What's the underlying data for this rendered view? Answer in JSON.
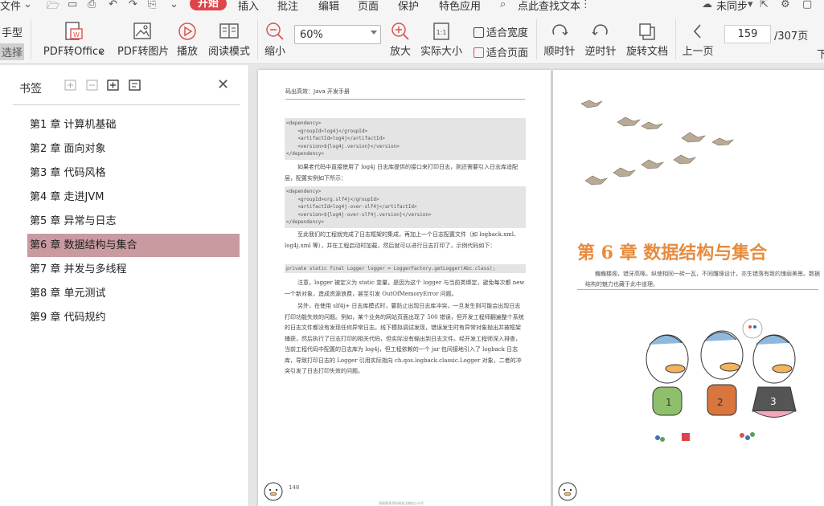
{
  "menubar": {
    "file": "文件",
    "start": "开始",
    "insert": "插入",
    "annotate": "批注",
    "edit": "编辑",
    "page": "页面",
    "protect": "保护",
    "features": "特色应用",
    "search": "点此查找文本",
    "sync": "未同步",
    "accent_color": "#e0444b"
  },
  "toolbar": {
    "hand": "手型",
    "select": "选择",
    "pdf_to_office": "PDF转Office",
    "pdf_to_image": "PDF转图片",
    "play": "播放",
    "read_mode": "阅读模式",
    "zoom_out": "缩小",
    "zoom_value": "60%",
    "zoom_in": "放大",
    "actual_size": "实际大小",
    "fit_width": "适合宽度",
    "fit_page": "适合页面",
    "rotate_cw": "顺时针",
    "rotate_ccw": "逆时针",
    "rotate_doc": "旋转文档",
    "prev_page": "上一页",
    "current_page": "159",
    "total_pages": "/307页",
    "next_page_partial": "下"
  },
  "sidebar": {
    "title": "书签",
    "items": [
      {
        "label": "第1 章 计算机基础"
      },
      {
        "label": "第2 章 面向对象"
      },
      {
        "label": "第3 章 代码风格"
      },
      {
        "label": "第4 章 走进JVM"
      },
      {
        "label": "第5 章 异常与日志"
      },
      {
        "label": "第6 章 数据结构与集合"
      },
      {
        "label": "第7 章 并发与多线程"
      },
      {
        "label": "第8 章 单元测试"
      },
      {
        "label": "第9 章 代码规约"
      }
    ],
    "selected_index": 5,
    "selected_color": "#c99aa0"
  },
  "page_left": {
    "header": "码出高效：Java 开发手册",
    "code1": [
      "<dependency>",
      "    <groupId>log4j</groupId>",
      "    <artifactId>log4j</artifactId>",
      "    <version>${log4j.version}</version>",
      "</dependency>"
    ],
    "p1": "如果老代码中直接使用了 log4j 日志库提供的接口来打印日志，则还需要引入日志库适配层，配置实例如下所示：",
    "code2": [
      "<dependency>",
      "    <groupId>org.slf4j</groupId>",
      "    <artifactId>log4j-over-slf4j</artifactId>",
      "    <version>${log4j-over-slf4j.version}</version>",
      "</dependency>"
    ],
    "p2": "至此我们的工程就完成了日志框架的集成，再加上一个日志配置文件（如 logback.xml、log4j.xml 等），并在工程启动时加载，然后就可以进行日志打印了，示例代码如下：",
    "code3": "private static final Logger logger = LoggerFactory.getLogger(Abc.class);",
    "p3": "注意，logger 被定义为 static 变量，是因为这个 logger 与当前类绑定，避免每次都 new 一个新对象，造成资源浪费，甚至引发 OutOfMemoryError 问题。",
    "p4": "另外，在使用 slf4j+ 日志库模式时，要防止出现日志库冲突，一旦发生则可能会出现日志打印功能失效的问题。例如，某个业务的网站页面出现了 500 错误，但开发工程师翻遍整个系统的日志文件都没有发现任何异常日志。线下模拟调试发现，错误发生时有异常对象抛出并被框架捕获，然后执行了日志打印的相关代码，但实际没有输出到日志文件。经开发工程师深入排查，当前工程代码中配置的日志库为 log4j，但工程依赖的一个 jar 包间接地引入了 logback 日志库，导致打印日志的 Logger 引用实际指向 ch.qos.logback.classic.Logger 对象，二者的冲突引发了日志打印失效的问题。",
    "page_number": "148",
    "footer": "获取更多资料请关注微信公众号"
  },
  "page_right": {
    "chapter_title": "第 6 章   数据结构与集合",
    "subtitle": "巍巍楼阁，错牙高啄。纵使相同一砖一瓦，不同雕琢设计，亦生错落有致的瑰丽美景。数据结构的魅力也藏于此中道理。",
    "title_color": "#e68b3f"
  }
}
